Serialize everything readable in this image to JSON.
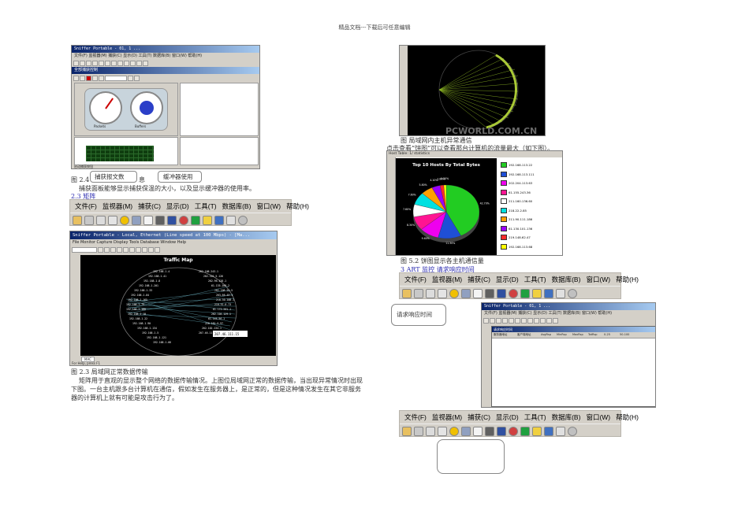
{
  "header": "精品文档---下载后可任意编辑",
  "left": {
    "screenshot1": {
      "title": "Sniffer Portable - 01, 1 ...",
      "menu": "文件(F)  监视器(M)  捕获(C)  显示(D)  工具(T)  数据库(B)  窗口(W)  帮助(H)",
      "panel_title": "全部捕获控制",
      "gauge1": "Packets",
      "gauge2": "Buffers",
      "status": "启动捕获按钮"
    },
    "fig_2_4_prefix": "图 2.4 ",
    "fig_2_4_suffix": "息",
    "callout_capture": "捕获报文数",
    "callout_buffer": "缓冲器使用",
    "panel_desc": "捕获面板能够显示捕获保温的大小，以及显示缓冲器的使用率。",
    "section_2_3": "2.3 矩阵",
    "menubar": [
      "文件(F)",
      "监视器(M)",
      "捕获(C)",
      "显示(D)",
      "工具(T)",
      "数据库(B)",
      "窗口(W)",
      "帮助(H)"
    ],
    "screenshot2": {
      "title": "Sniffer Portable - Local, Ethernet (Line speed at 100 Mbps) - [Ma...",
      "menu": "File  Monitor  Capture  Display  Tools  Database  Window  Help",
      "map_title": "Traffic Map",
      "status": "For Help, press F1",
      "tab": "MAC"
    },
    "fig_2_3": "图  2.3 局域网正常数据传输",
    "paragraph": "矩阵用于直观的显示整个网络的数据传输情况。上图位局域网正常的数据传输，当出现异常情况时出现下图。一台主机跟多台计算机在通信，假如发生在服务器上，是正常的，但是这种情况发生在其它非服务器的计算机上就有可能是攻击行为了。"
  },
  "right": {
    "fig_abnormal": "图    局域网内主机异常通信",
    "pie_intro": "点击查看“饼图”可以查看那台计算机的流量最大（如下图）。",
    "pie_window_title": "Host Table: 1/ statistics",
    "watermark": "PCWORLD.COM.CN",
    "fig_5_2": "图  5.2 饼图显示各主机通信量",
    "section_3": "3    ART 监控  请求响应时间",
    "callout_response": "请求响应时间",
    "screenshot3": {
      "title": "Sniffer Portable - 01, 1 ...",
      "menu": "文件(F) 监视器(M) 捕获(C) 显示(D) 工具(T) 数据库(B) 窗口(W) 帮助(H)",
      "subtitle": "请求响应时间",
      "columns": [
        "服务器地址",
        "客户端地址",
        "AvgRsp",
        "MinRsp",
        "MaxRsp",
        "TotRsp",
        "0-25",
        "50-100"
      ]
    }
  },
  "chart_data": {
    "type": "pie",
    "title": "Top 10 Hosts By Total Bytes",
    "categories": [
      "192.168.113.22",
      "192.168.113.111",
      "202.204.113.63",
      "61.155.243.36",
      "211.160.136.60",
      "218.22.2.85",
      "211.90.111.186",
      "61.130.101.136",
      "219.148.62.47",
      "192.168.113.68"
    ],
    "values": [
      42.7,
      11.3,
      9.6,
      8.3,
      7.6,
      7.6,
      5.8,
      4.1,
      1.8,
      1.2
    ],
    "data_labels": [
      "42.70%",
      "11.30%",
      "9.60%",
      "8.30%",
      "7.60%",
      "7.60%",
      "5.80%",
      "4.10%",
      "1.80%",
      "1.20%"
    ],
    "colors": [
      "#22cc22",
      "#1f4fd6",
      "#ee00ee",
      "#ff1493",
      "#ffffff",
      "#00e0e0",
      "#ffa000",
      "#9b00ff",
      "#ff2a2a",
      "#ffff00"
    ],
    "legend": "right"
  }
}
